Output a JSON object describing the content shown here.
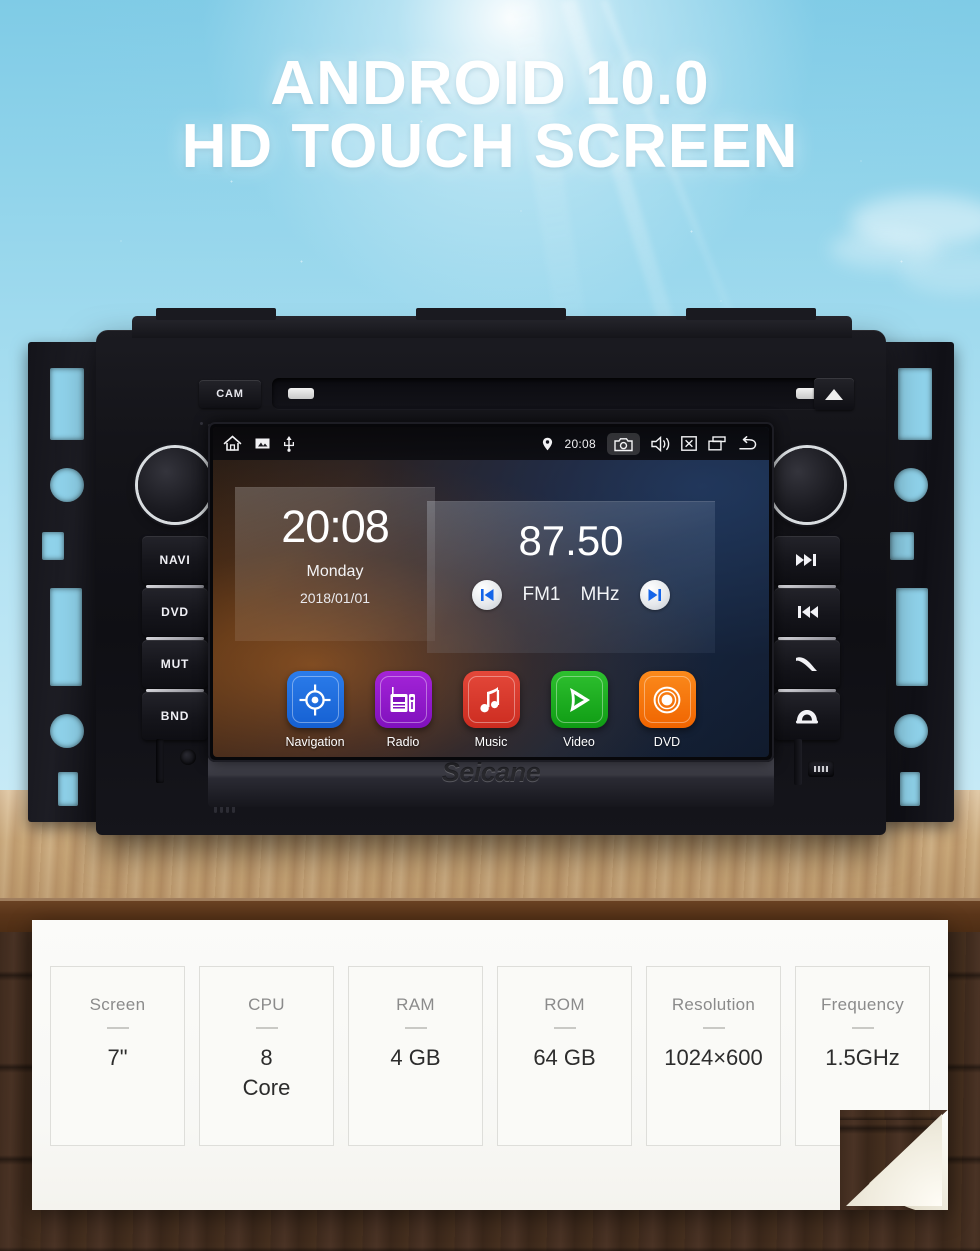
{
  "hero": {
    "line1": "ANDROID 10.0",
    "line2": "HD TOUCH SCREEN"
  },
  "device": {
    "brand": "Seicane",
    "top_buttons": {
      "camera_label": "CAM",
      "eject_icon": "eject-triangle-icon",
      "disc_slot": "disc-slot"
    },
    "left_buttons": [
      {
        "label": "NAVI",
        "name": "navi-button"
      },
      {
        "label": "DVD",
        "name": "dvd-button"
      },
      {
        "label": "MUT",
        "name": "mute-button"
      },
      {
        "label": "BND",
        "name": "band-button"
      }
    ],
    "right_buttons": [
      {
        "icon": "next-track-icon",
        "name": "next-track-button"
      },
      {
        "icon": "prev-track-icon",
        "name": "prev-track-button"
      },
      {
        "icon": "answer-call-icon",
        "name": "answer-call-button"
      },
      {
        "icon": "end-call-icon",
        "name": "end-call-button"
      }
    ],
    "knobs": [
      {
        "name": "left-volume-knob"
      },
      {
        "name": "right-tune-knob"
      }
    ],
    "ports": {
      "sd_slot": "sd-card-slot",
      "reset": "reset-hole",
      "usb": "usb-port"
    }
  },
  "screen": {
    "statusbar": {
      "home_icon": "home-icon",
      "gallery_icon": "image-icon",
      "usb_icon": "usb-icon",
      "location_icon": "location-pin-icon",
      "time": "20:08",
      "camera_icon": "camera-icon",
      "volume_icon": "speaker-icon",
      "close_icon": "close-box-icon",
      "recents_icon": "recent-apps-icon",
      "back_icon": "back-arrow-icon"
    },
    "clock_widget": {
      "time": "20:08",
      "weekday": "Monday",
      "date": "2018/01/01"
    },
    "radio_widget": {
      "frequency": "87.50",
      "band": "FM1",
      "unit": "MHz",
      "prev_icon": "skip-previous-icon",
      "next_icon": "skip-next-icon"
    },
    "apps": [
      {
        "label": "Navigation",
        "color": "#1f6fe0",
        "icon": "navigation-target-icon"
      },
      {
        "label": "Radio",
        "color": "#8e17c4",
        "icon": "radio-receiver-icon"
      },
      {
        "label": "Music",
        "color": "#d8382b",
        "icon": "music-note-icon"
      },
      {
        "label": "Video",
        "color": "#17a81f",
        "icon": "video-play-icon"
      },
      {
        "label": "DVD",
        "color": "#f4740a",
        "icon": "dvd-disc-icon"
      }
    ]
  },
  "specs": [
    {
      "label": "Screen",
      "value": "7\""
    },
    {
      "label": "CPU",
      "value": "8\nCore"
    },
    {
      "label": "RAM",
      "value": "4 GB"
    },
    {
      "label": "ROM",
      "value": "64 GB"
    },
    {
      "label": "Resolution",
      "value": "1024×600"
    },
    {
      "label": "Frequency",
      "value": "1.5GHz"
    }
  ],
  "colors": {
    "sky": "#a4dcef",
    "paper": "#fbfbf9",
    "wood_light": "#ccA878",
    "wood_dark": "#40291b",
    "accent_blue": "#1f6fe0"
  }
}
